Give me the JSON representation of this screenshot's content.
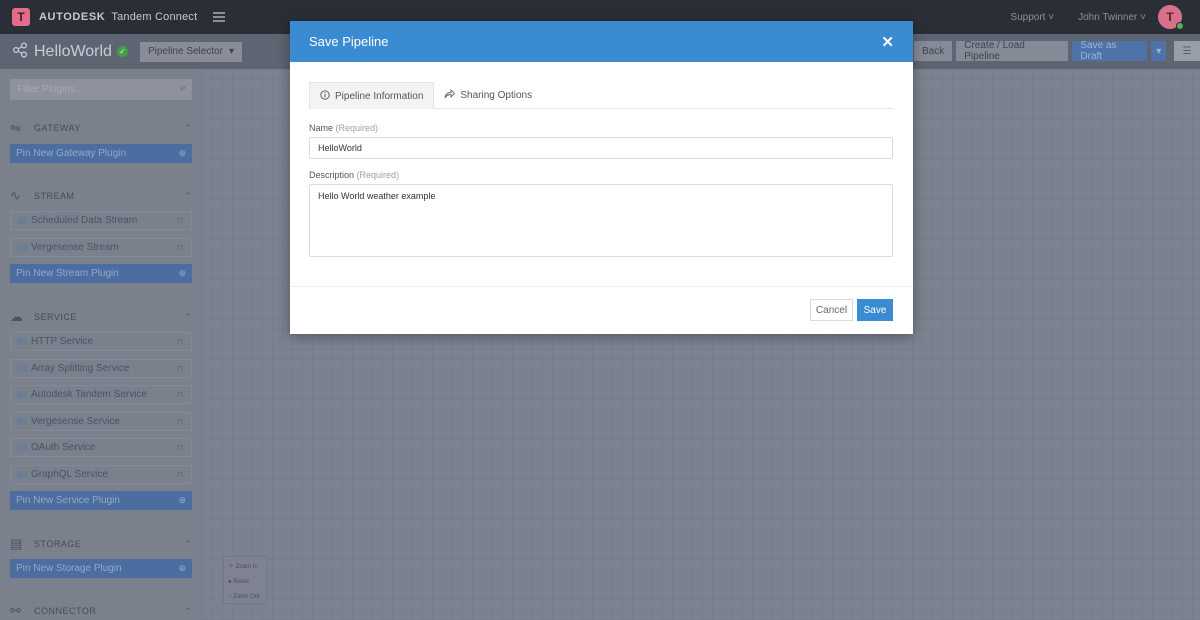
{
  "topbar": {
    "logo_letter": "T",
    "brand_bold": "AUTODESK",
    "brand_rest": "Tandem Connect",
    "support_menu": "Support ˅",
    "user_menu": "John Twinner ˅",
    "avatar_letter": "T"
  },
  "pipeline_bar": {
    "pipeline_name": "HelloWorld",
    "selector_label": "Pipeline Selector",
    "back_label": "Back",
    "create_load_label": "Create / Load Pipeline",
    "save_draft_label": "Save as Draft"
  },
  "sidebar": {
    "filter_placeholder": "Filter Plugins...",
    "sections": {
      "gateway": {
        "title": "GATEWAY",
        "pin_label": "Pin New Gateway Plugin",
        "items": []
      },
      "stream": {
        "title": "STREAM",
        "pin_label": "Pin New Stream Plugin",
        "items": [
          "Scheduled Data Stream",
          "Vergesense Stream"
        ]
      },
      "service": {
        "title": "SERVICE",
        "pin_label": "Pin New Service Plugin",
        "items": [
          "HTTP Service",
          "Array Splitting Service",
          "Autodesk Tandem Service",
          "Vergesense Service",
          "OAuth Service",
          "GraphQL Service"
        ]
      },
      "storage": {
        "title": "STORAGE",
        "pin_label": "Pin New Storage Plugin",
        "items": []
      },
      "connector": {
        "title": "CONNECTOR"
      }
    }
  },
  "zoom_controls": {
    "zoom_in": "Zoom In",
    "reset": "Reset",
    "zoom_out": "Zoom Out"
  },
  "modal": {
    "title": "Save Pipeline",
    "close_glyph": "✕",
    "tabs": [
      {
        "label": "Pipeline Information",
        "icon": "info-icon",
        "active": true
      },
      {
        "label": "Sharing Options",
        "icon": "share-icon",
        "active": false
      }
    ],
    "name_label": "Name",
    "name_required": "(Required)",
    "name_value": "HelloWorld",
    "description_label": "Description",
    "description_required": "(Required)",
    "description_value": "Hello World weather example",
    "cancel_label": "Cancel",
    "save_label": "Save"
  },
  "colors": {
    "primary": "#3a8bd1",
    "topbar": "#2a2e36",
    "overlay_background": "#7d8291",
    "status_ok": "#43a047",
    "avatar": "#d9708a"
  }
}
